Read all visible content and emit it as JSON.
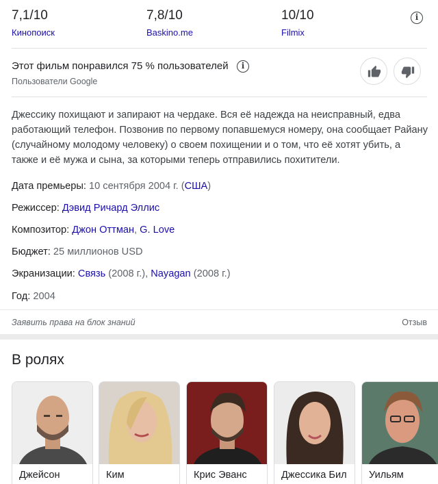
{
  "ratings": [
    {
      "score": "7,1/10",
      "source": "Кинопоиск"
    },
    {
      "score": "7,8/10",
      "source": "Baskino.me"
    },
    {
      "score": "10/10",
      "source": "Filmix"
    }
  ],
  "info_glyph": "i",
  "audience": {
    "text": "Этот фильм понравился 75 % пользователей",
    "source": "Пользователи Google"
  },
  "description": "Джессику похищают и запирают на чердаке. Вся её надежда на неисправный, едва работающий телефон. Позвонив по первому попавшемуся номеру, она сообщает Райану (случайному молодому человеку) о своем похищении и о том, что её хотят убить, а также и её мужа и сына, за которыми теперь отправились похитители.",
  "facts": {
    "premiere": {
      "label": "Дата премьеры:",
      "date": "10 сентября 2004 г. (",
      "country": "США",
      "close": ")"
    },
    "director": {
      "label": "Режиссер:",
      "name": "Дэвид Ричард Эллис"
    },
    "composer": {
      "label": "Композитор:",
      "name1": "Джон Оттман",
      "sep": ",",
      "name2": "G. Love"
    },
    "budget": {
      "label": "Бюджет:",
      "value": "25 миллионов USD"
    },
    "adaptations": {
      "label": "Экранизации:",
      "title1": "Связь",
      "year1": "(2008 г.),",
      "title2": "Nayagan",
      "year2": "(2008 г.)"
    },
    "year": {
      "label": "Год:",
      "value": "2004"
    }
  },
  "footer": {
    "claim": "Заявить права на блок знаний",
    "feedback": "Отзыв"
  },
  "cast": {
    "title": "В ролях",
    "members": [
      {
        "name": "Джейсон"
      },
      {
        "name": "Ким"
      },
      {
        "name": "Крис Эванс"
      },
      {
        "name": "Джессика Бил"
      },
      {
        "name": "Уильям"
      }
    ]
  }
}
